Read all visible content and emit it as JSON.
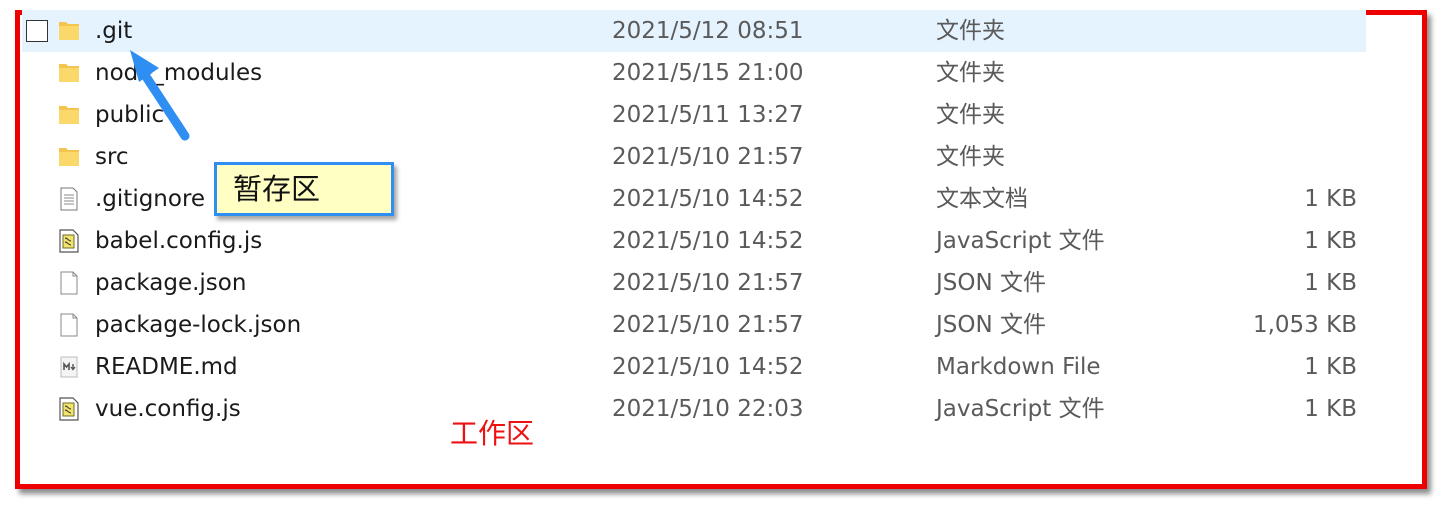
{
  "files": [
    {
      "name": ".git",
      "date": "2021/5/12 08:51",
      "type": "文件夹",
      "size": "",
      "icon": "folder-icon",
      "selected": true
    },
    {
      "name": "node_modules",
      "date": "2021/5/15 21:00",
      "type": "文件夹",
      "size": "",
      "icon": "folder-icon",
      "selected": false
    },
    {
      "name": "public",
      "date": "2021/5/11 13:27",
      "type": "文件夹",
      "size": "",
      "icon": "folder-icon",
      "selected": false
    },
    {
      "name": "src",
      "date": "2021/5/10 21:57",
      "type": "文件夹",
      "size": "",
      "icon": "folder-icon",
      "selected": false
    },
    {
      "name": ".gitignore",
      "date": "2021/5/10 14:52",
      "type": "文本文档",
      "size": "1 KB",
      "icon": "text-file-icon",
      "selected": false
    },
    {
      "name": "babel.config.js",
      "date": "2021/5/10 14:52",
      "type": "JavaScript 文件",
      "size": "1 KB",
      "icon": "script-file-icon",
      "selected": false
    },
    {
      "name": "package.json",
      "date": "2021/5/10 21:57",
      "type": "JSON 文件",
      "size": "1 KB",
      "icon": "blank-file-icon",
      "selected": false
    },
    {
      "name": "package-lock.json",
      "date": "2021/5/10 21:57",
      "type": "JSON 文件",
      "size": "1,053 KB",
      "icon": "blank-file-icon",
      "selected": false
    },
    {
      "name": "README.md",
      "date": "2021/5/10 14:52",
      "type": "Markdown File",
      "size": "1 KB",
      "icon": "markdown-file-icon",
      "selected": false
    },
    {
      "name": "vue.config.js",
      "date": "2021/5/10 22:03",
      "type": "JavaScript 文件",
      "size": "1 KB",
      "icon": "script-file-icon",
      "selected": false
    }
  ],
  "annotations": {
    "staging_label": "暂存区",
    "workspace_label": "工作区"
  },
  "colors": {
    "frame": "#ee0000",
    "callout_border": "#2f8ef2",
    "callout_fill": "#ffffc4",
    "arrow": "#2f8ef2",
    "selection": "#e5f3ff",
    "folder": "#f3c54f"
  }
}
